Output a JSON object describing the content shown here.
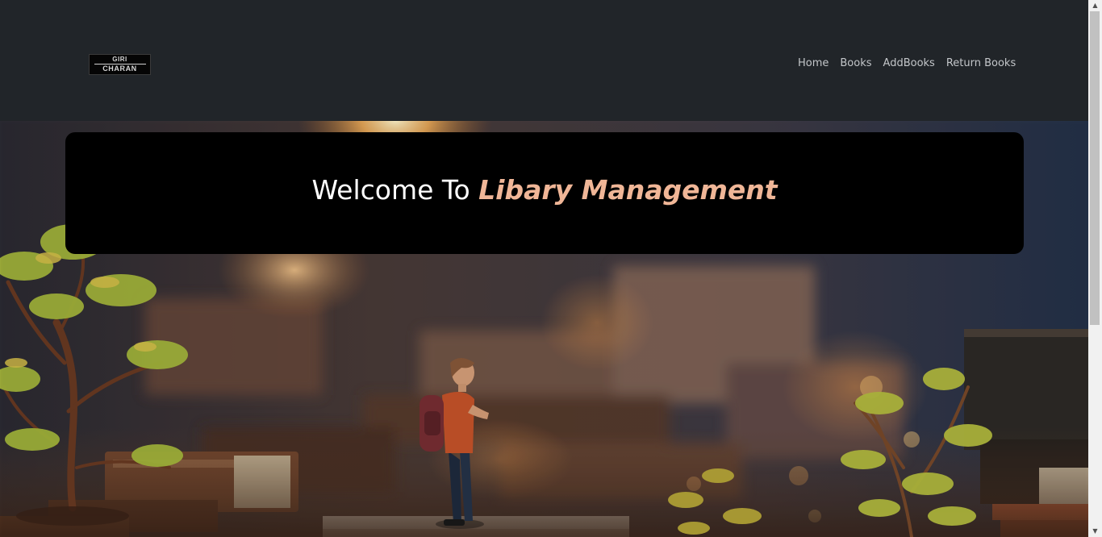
{
  "header": {
    "logo": {
      "line1": "GIRI",
      "line2": "CHARAN"
    },
    "nav": [
      {
        "label": "Home"
      },
      {
        "label": "Books"
      },
      {
        "label": "AddBooks"
      },
      {
        "label": "Return Books"
      }
    ]
  },
  "hero": {
    "title_prefix": "Welcome To ",
    "title_accent": "Libary Management",
    "accent_color": "#f0b697",
    "background_image": "library-figure-with-backpack-among-books-and-plants"
  },
  "scrollbar": {
    "up_icon": "scroll-up-arrow-icon",
    "down_icon": "scroll-down-arrow-icon"
  }
}
